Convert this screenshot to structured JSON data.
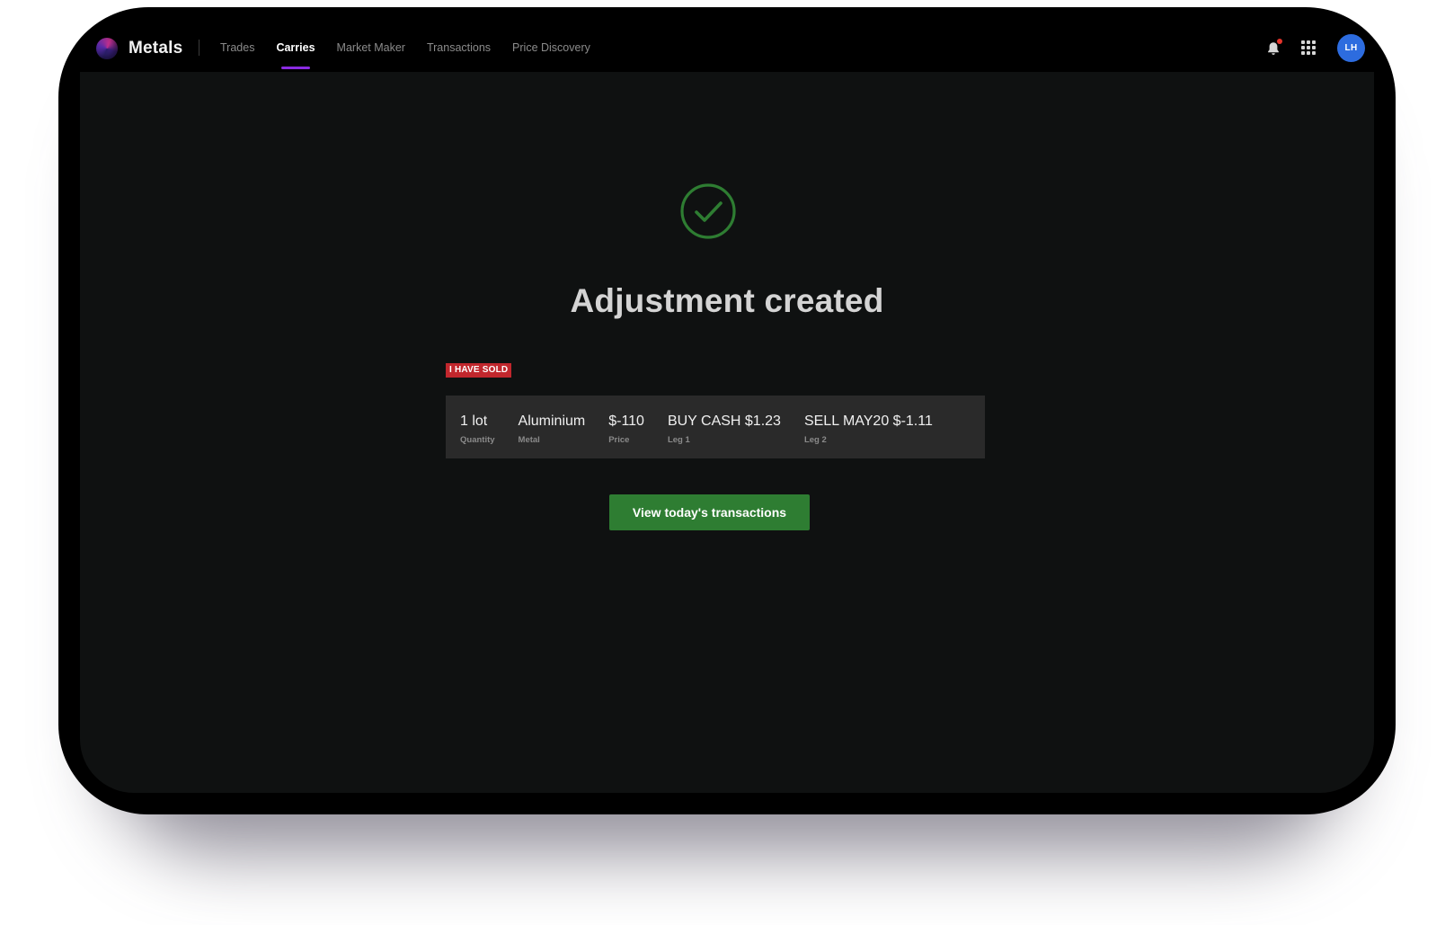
{
  "app": {
    "name": "Metals"
  },
  "nav": {
    "tabs": [
      {
        "label": "Trades",
        "active": false
      },
      {
        "label": "Carries",
        "active": true
      },
      {
        "label": "Market Maker",
        "active": false
      },
      {
        "label": "Transactions",
        "active": false
      },
      {
        "label": "Price Discovery",
        "active": false
      }
    ],
    "notifications_icon": "bell-icon",
    "apps_icon": "grid-icon",
    "user_initials": "LH"
  },
  "confirmation": {
    "icon": "check-circle-icon",
    "title": "Adjustment created",
    "badge": "I HAVE SOLD",
    "details": [
      {
        "value": "1 lot",
        "label": "Quantity"
      },
      {
        "value": "Aluminium",
        "label": "Metal"
      },
      {
        "value": "$-110",
        "label": "Price"
      },
      {
        "value": "BUY CASH $1.23",
        "label": "Leg 1"
      },
      {
        "value": "SELL MAY20 $-1.11",
        "label": "Leg 2"
      }
    ],
    "cta_label": "View today's transactions"
  },
  "colors": {
    "accent": "#8a2be2",
    "success": "#2e7d32",
    "badge": "#c1272d",
    "avatar": "#2d6cdf",
    "background": "#0f1111"
  }
}
